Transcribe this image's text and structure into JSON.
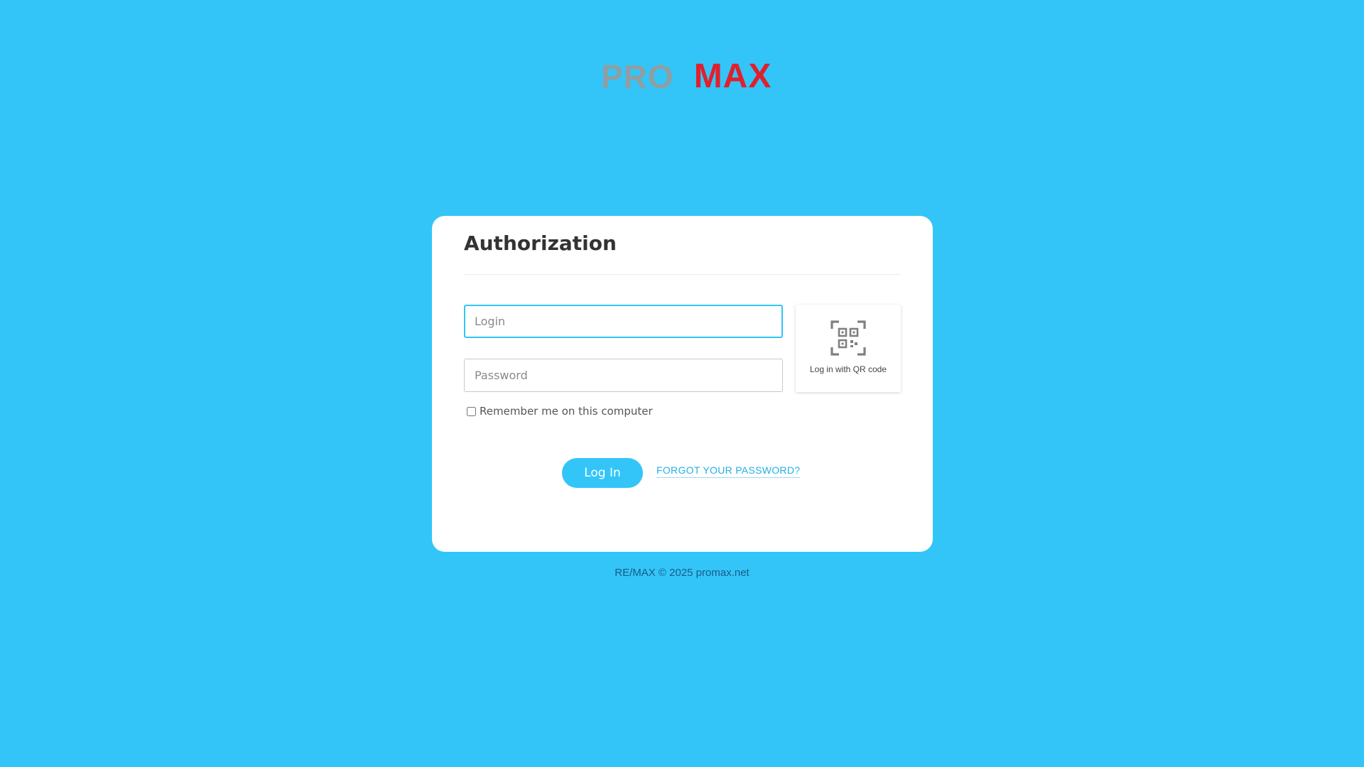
{
  "logo": {
    "left_text": "PRO",
    "right_text": "MAX",
    "colors": {
      "pro": "#9a9a9a",
      "max": "#e0202c"
    }
  },
  "card": {
    "title": "Authorization",
    "login_placeholder": "Login",
    "password_placeholder": "Password",
    "remember_label": "Remember me on this computer",
    "qr_icon": "qr-code-icon",
    "qr_label": "Log in with QR code",
    "login_button": "Log In",
    "forgot_link": "FORGOT YOUR PASSWORD?"
  },
  "footer": {
    "text": "RE/MAX © 2025 promax.net"
  },
  "colors": {
    "background": "#33c5f8",
    "accent": "#33c5f8",
    "link": "#21b0e4"
  }
}
